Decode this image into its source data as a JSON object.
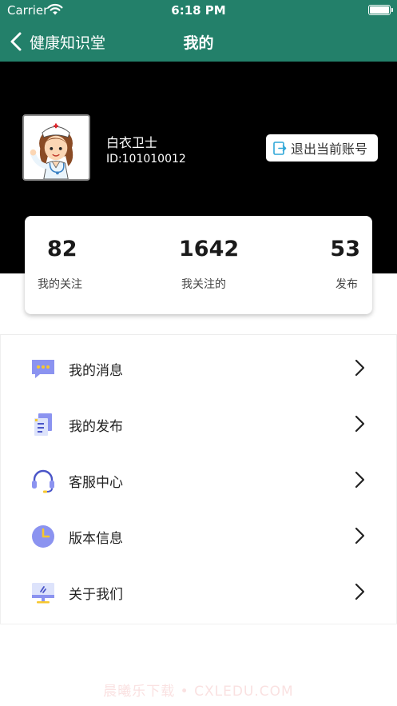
{
  "status_bar": {
    "carrier": "Carrier",
    "time": "6:18 PM"
  },
  "nav": {
    "back_label": "健康知识堂",
    "title": "我的"
  },
  "profile": {
    "name": "白衣卫士",
    "id_text": "ID:101010012",
    "logout_label": "退出当前账号"
  },
  "stats": [
    {
      "value": "82",
      "label": "我的关注"
    },
    {
      "value": "1642",
      "label": "我关注的"
    },
    {
      "value": "53",
      "label": "发布"
    }
  ],
  "menu": [
    {
      "label": "我的消息",
      "icon": "message-icon"
    },
    {
      "label": "我的发布",
      "icon": "document-icon"
    },
    {
      "label": "客服中心",
      "icon": "headset-icon"
    },
    {
      "label": "版本信息",
      "icon": "clock-icon"
    },
    {
      "label": "关于我们",
      "icon": "monitor-icon"
    }
  ],
  "watermark": "晨曦乐下载 • CXLEDU.COM",
  "colors": {
    "brand_green": "#23806a",
    "header_black": "#000000",
    "icon_purple": "#8b93f0",
    "icon_yellow": "#f7c72e",
    "logout_icon": "#2fa7d8"
  }
}
